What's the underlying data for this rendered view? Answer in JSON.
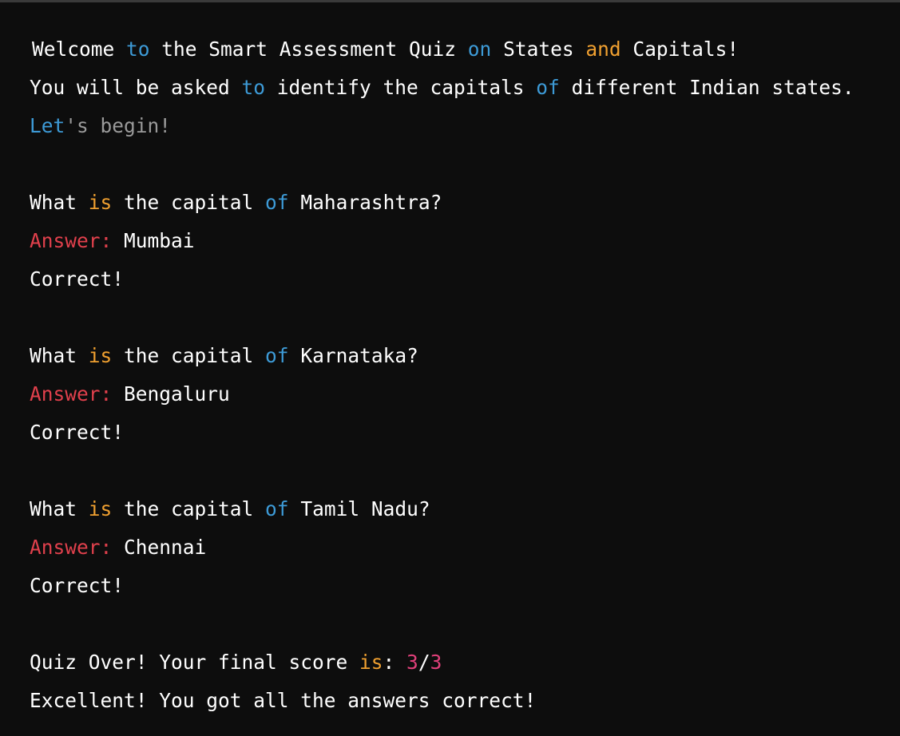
{
  "colors": {
    "background": "#0d0d0d",
    "text": "#ffffff",
    "keyword_blue": "#3d9ad6",
    "keyword_orange": "#f0a030",
    "muted": "#9a9a9a",
    "answer_label": "#e0404c",
    "number": "#e0407a"
  },
  "intro": {
    "line1": {
      "w1": "Welcome ",
      "k1": "to",
      "w2": " the Smart Assessment Quiz ",
      "k2": "on",
      "w3": " States ",
      "k3": "and",
      "w4": " Capitals!"
    },
    "line2": {
      "w1": "You will be asked ",
      "k1": "to",
      "w2": " identify the capitals ",
      "k2": "of",
      "w3": " different Indian states."
    },
    "line3": {
      "k1": "Let",
      "w1": "'s begin!"
    }
  },
  "questions": [
    {
      "prefix": "What ",
      "kw_is": "is",
      "middle": " the capital ",
      "kw_of": "of",
      "state": " Maharashtra?",
      "answer_label": "Answer:",
      "answer": " Mumbai",
      "result": "Correct!"
    },
    {
      "prefix": "What ",
      "kw_is": "is",
      "middle": " the capital ",
      "kw_of": "of",
      "state": " Karnataka?",
      "answer_label": "Answer:",
      "answer": " Bengaluru",
      "result": "Correct!"
    },
    {
      "prefix": "What ",
      "kw_is": "is",
      "middle": " the capital ",
      "kw_of": "of",
      "state": " Tamil Nadu?",
      "answer_label": "Answer:",
      "answer": " Chennai",
      "result": "Correct!"
    }
  ],
  "summary": {
    "prefix": "Quiz Over! Your final score ",
    "kw_is": "is",
    "colon": ": ",
    "score": "3",
    "slash": "/",
    "total": "3",
    "closing": "Excellent! You got all the answers correct!"
  }
}
